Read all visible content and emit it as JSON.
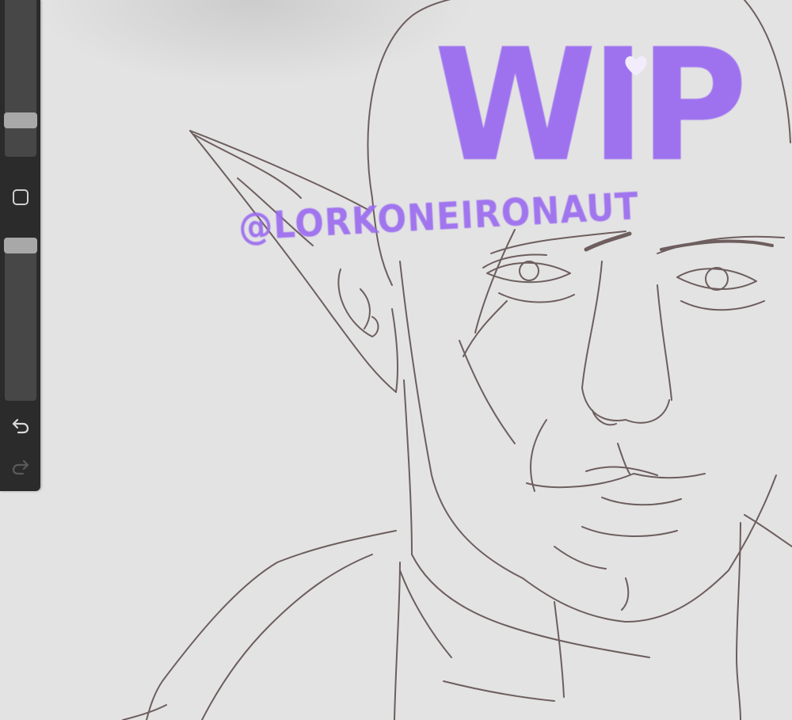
{
  "app": {
    "name": "drawing canvas"
  },
  "canvas": {
    "background": "#e3e3e3",
    "sketch_color": "#5a4a4a",
    "subject": "line sketch of an elf with pointed ear"
  },
  "watermark": {
    "title": "WIP",
    "handle": "@LORKONEIRONAUT",
    "color": "#9b6cf0"
  },
  "sidebar": {
    "background": "#2b2b2b",
    "brush_size_level": 0.27,
    "brush_opacity_level": 1.0,
    "icons": {
      "modify": "square-icon",
      "undo": "undo-icon",
      "redo": "redo-icon"
    }
  }
}
